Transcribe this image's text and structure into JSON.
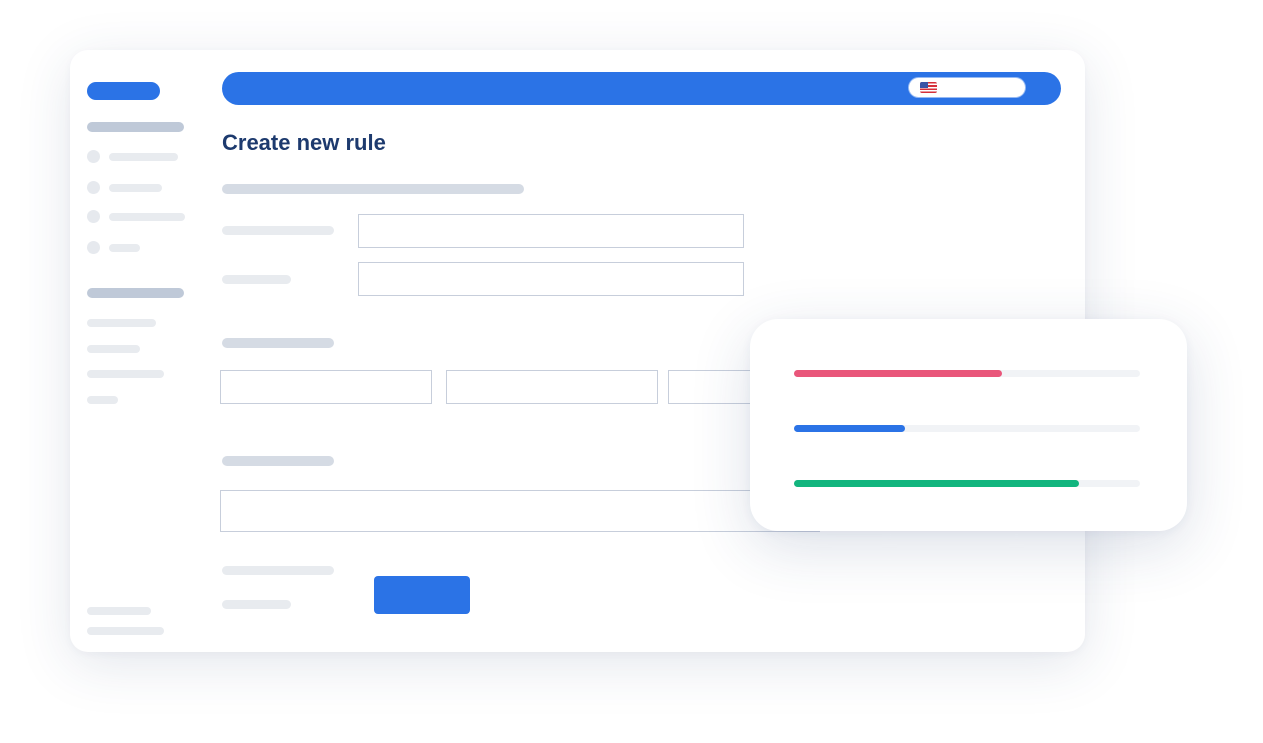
{
  "page_title": "Create new rule",
  "header": {
    "language_flag_icon": "us-flag-icon"
  },
  "progress_bars": [
    {
      "name": "red",
      "color": "#e9567a",
      "progress": 0.6
    },
    {
      "name": "blue",
      "color": "#2b73e6",
      "progress": 0.32
    },
    {
      "name": "green",
      "color": "#12b57e",
      "progress": 0.825
    }
  ],
  "colors": {
    "accent": "#2b73e6",
    "title": "#1d3a6e",
    "placeholder_dark": "#bfc9d8",
    "placeholder_light": "#e8ebef",
    "field_border": "#c7cedb"
  }
}
